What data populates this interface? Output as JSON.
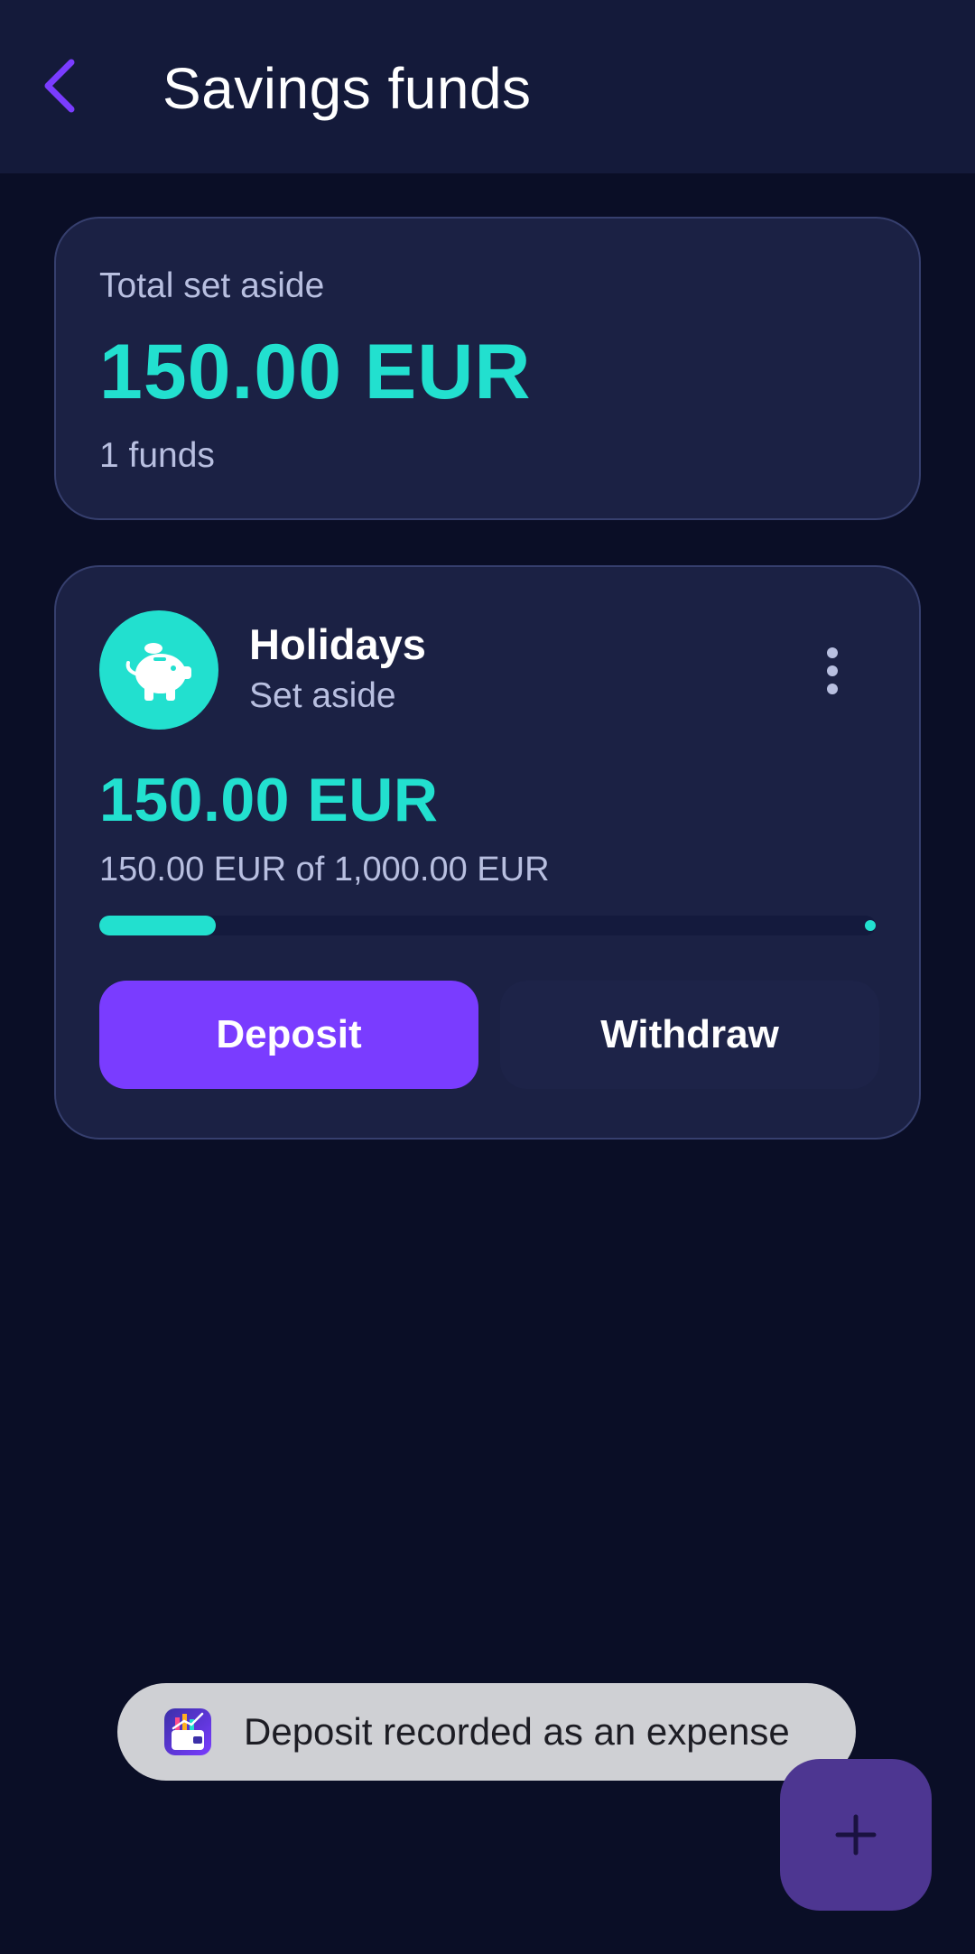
{
  "header": {
    "title": "Savings funds",
    "back_icon": "chevron-left-icon"
  },
  "summary": {
    "label": "Total set aside",
    "amount": "150.00 EUR",
    "count": "1 funds"
  },
  "fund": {
    "name": "Holidays",
    "status": "Set aside",
    "icon": "piggy-bank-icon",
    "amount": "150.00 EUR",
    "progress_text": "150.00 EUR of 1,000.00 EUR",
    "progress_fraction": 0.15,
    "deposit_label": "Deposit",
    "withdraw_label": "Withdraw"
  },
  "toast": {
    "message": "Deposit recorded as an expense",
    "icon": "app-wallet-icon"
  },
  "fab": {
    "icon": "plus-icon"
  },
  "colors": {
    "accent": "#22e0cf",
    "primary": "#7a3cff",
    "background": "#0a0e26",
    "card": "#1b2144"
  }
}
